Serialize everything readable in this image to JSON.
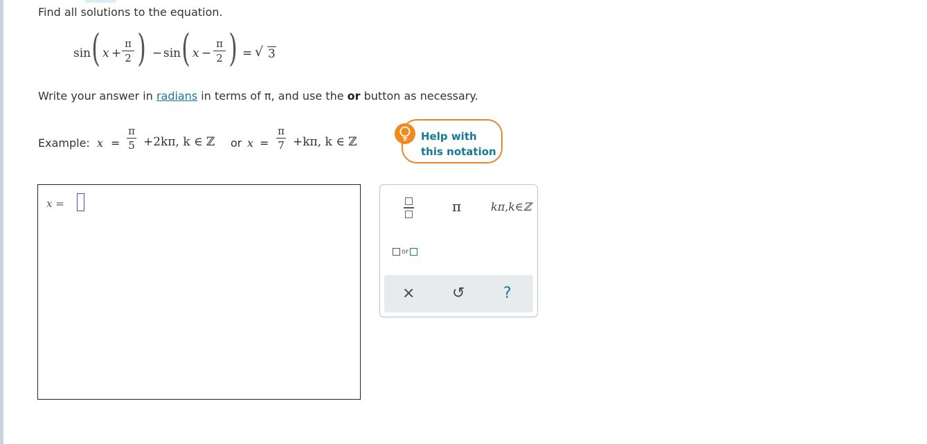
{
  "prompt": "Find all solutions to the equation.",
  "equation": {
    "sin1": "sin",
    "x1": "x",
    "plus": "+",
    "pi_num": "π",
    "den2": "2",
    "minus": "−",
    "sin2": "sin",
    "x2": "x",
    "minus2": "−",
    "eq": "=",
    "sqrt_sym": "√",
    "three": "3"
  },
  "instructions": {
    "part1": "Write your answer in ",
    "link": "radians",
    "part2": " in terms of π, and use the ",
    "bold": "or",
    "part3": " button as necessary."
  },
  "example": {
    "label": "Example: ",
    "x": "x",
    "eq": "=",
    "pi": "π",
    "den1": "5",
    "term1": "+2kπ, k ∈ ℤ",
    "or": "or ",
    "x2": "x",
    "eq2": "=",
    "pi2": "π",
    "den2": "7",
    "term2": "+kπ, k ∈ ℤ"
  },
  "help": {
    "line1": "Help with",
    "line2": "this notation"
  },
  "answer": {
    "lhs": "x ="
  },
  "palette": {
    "pi": "π",
    "kpi": "kπ,k∈ℤ",
    "or": "or",
    "clear": "×",
    "undo": "↺",
    "help": "?"
  }
}
